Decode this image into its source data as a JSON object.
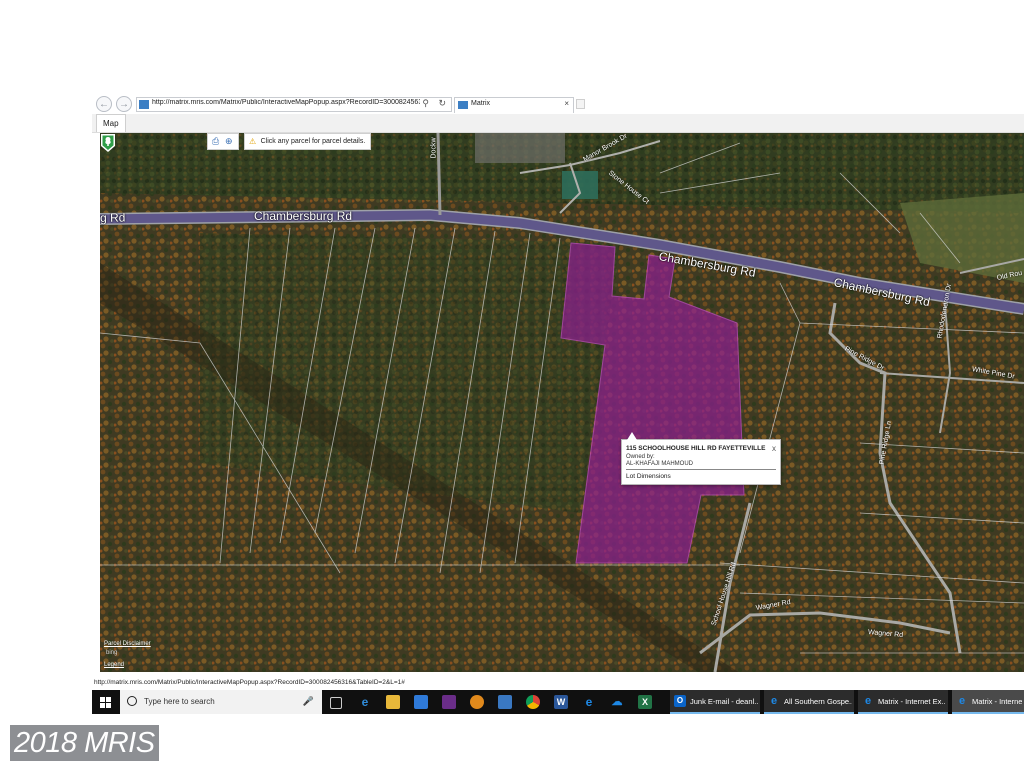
{
  "browser": {
    "address_url": "http://matrix.mris.com/Matrix/Public/InteractiveMapPopup.aspx?RecordID=3000824563",
    "tab_title": "Matrix",
    "tab_close": "×",
    "back_icon": "arrow-left-icon",
    "forward_icon": "arrow-right-icon"
  },
  "page_tab": {
    "label": "Map"
  },
  "map_toolbar": {
    "hint": "Click any parcel for parcel details."
  },
  "map_labels": {
    "chambersburg_left": "rg Rd",
    "chambersburg_1": "Chambersburg Rd",
    "chambersburg_2": "Chambersburg Rd",
    "chambersburg_3": "Chambersburg Rd",
    "old_rou": "Old Rou",
    "white_pine": "White Pine Dr",
    "pine_ridge_dr": "Pine Ridge Dr",
    "rhododendron": "Rhododendron Dr",
    "pine_ridge_ln": "Pine Ridge Ln",
    "school_house": "School House Hill Rd",
    "wagner_1": "Wagner Rd",
    "wagner_2": "Wagner Rd",
    "dockw": "Dockw",
    "manor": "Manor Brook Dr",
    "stone": "Stone House Ct"
  },
  "popup": {
    "address": "115 SCHOOLHOUSE HILL RD FAYETTEVILLE",
    "owned_label": "Owned by:",
    "owner": "AL-KHAFAJI MAHMOUD",
    "lot_link": "Lot Dimensions",
    "close": "x"
  },
  "map_footer": {
    "disclaimer": "Parcel Disclaimer",
    "attribution": "bing",
    "legend": "Legend"
  },
  "status_url": "http://matrix.mris.com/Matrix/Public/InteractiveMapPopup.aspx?RecordID=300082456316&TableID=2&L=1#",
  "taskbar": {
    "search_placeholder": "Type here to search",
    "apps": [
      {
        "label": "Junk E-mail - deanl...",
        "icon": "outlook-icon",
        "color": "#0a64c8"
      },
      {
        "label": "All Southern Gospe...",
        "icon": "ie-icon",
        "color": "#1e88e5"
      },
      {
        "label": "Matrix - Internet Ex...",
        "icon": "ie-icon",
        "color": "#1e88e5"
      },
      {
        "label": "Matrix - Internet E",
        "icon": "ie-icon",
        "color": "#1e88e5"
      }
    ]
  },
  "colors": {
    "parcel": "#8d1f8f",
    "taskbar": "#101010",
    "accent": "#76b9ed"
  },
  "watermark": "2018 MRIS"
}
